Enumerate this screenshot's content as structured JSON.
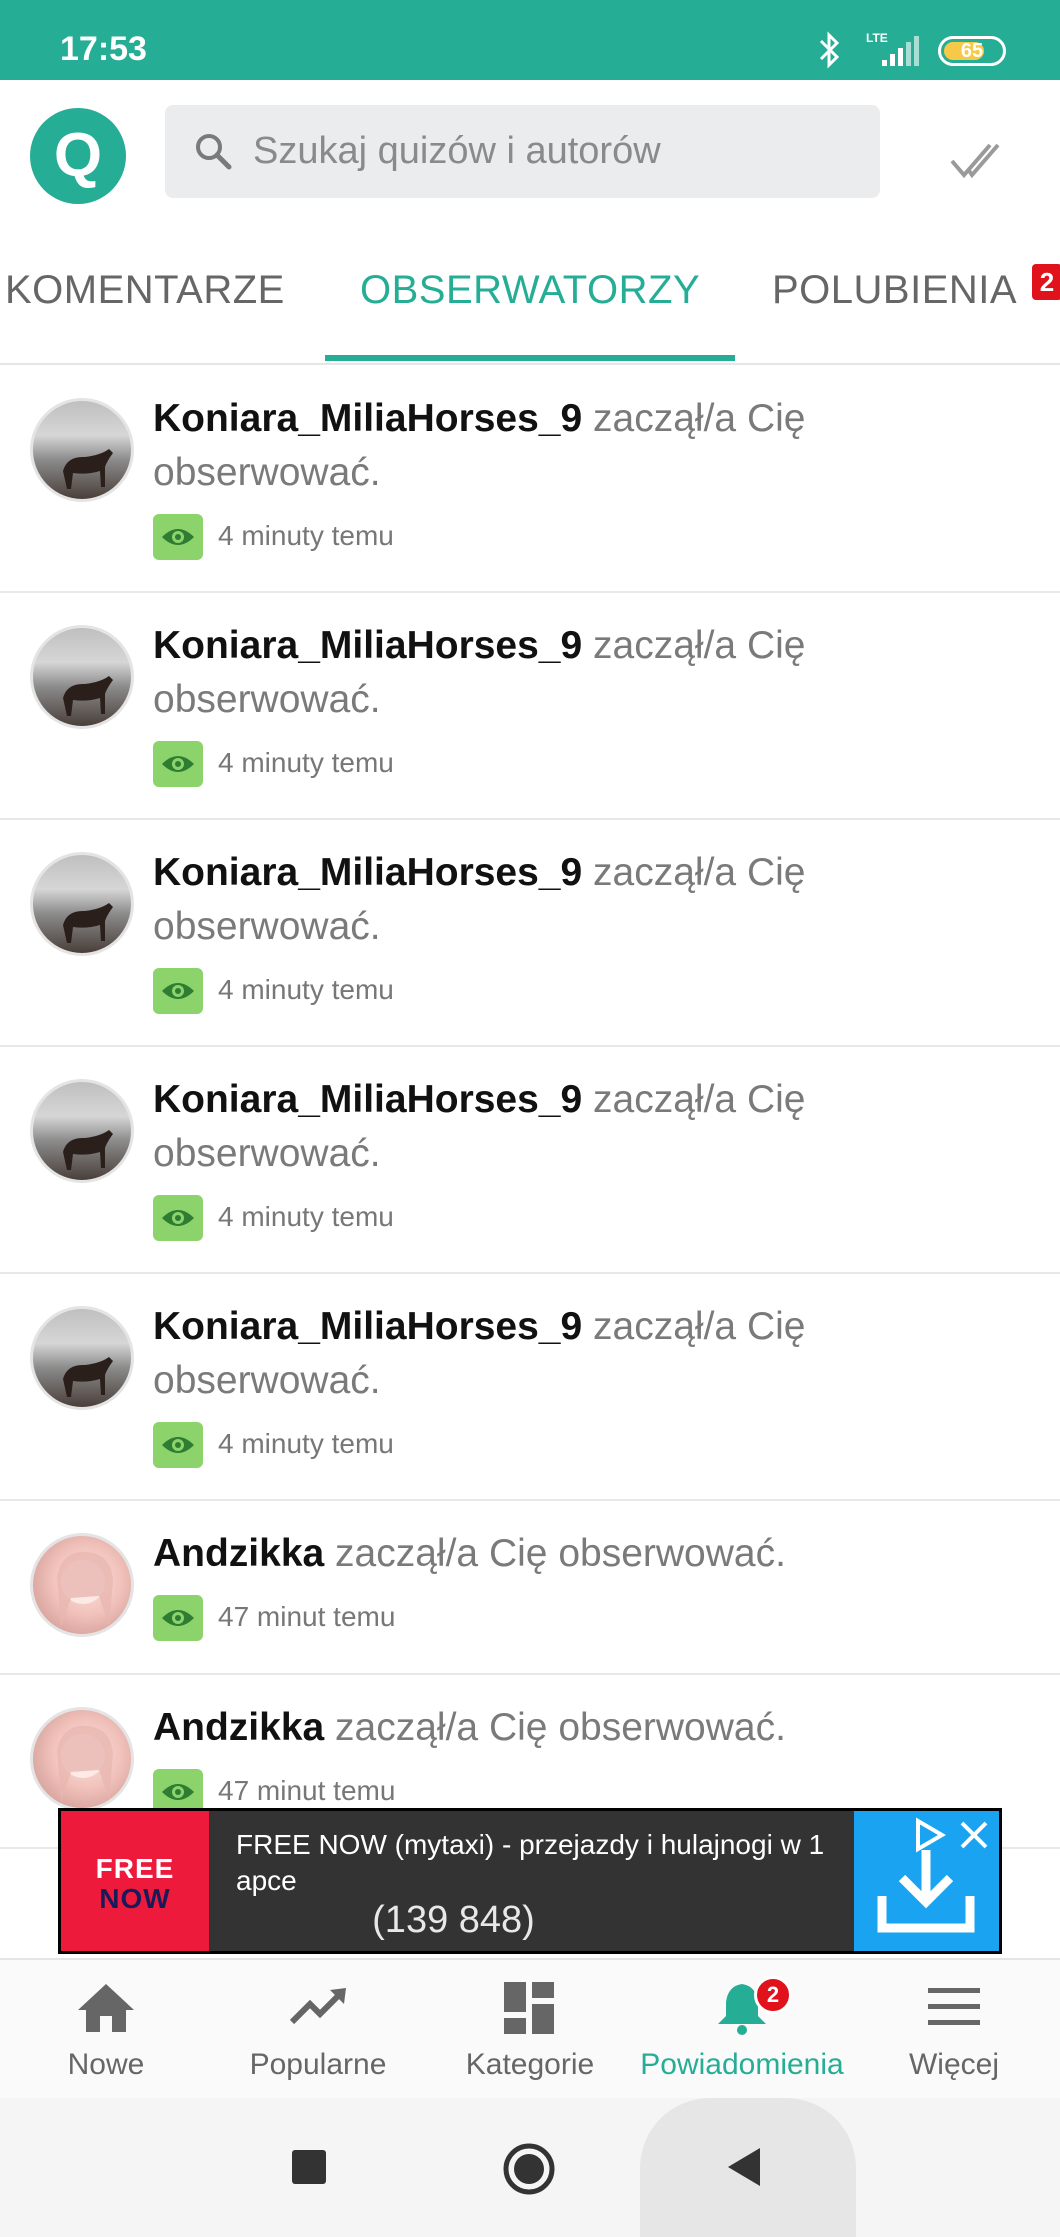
{
  "status_bar": {
    "time": "17:53",
    "network": "LTE",
    "battery": "65"
  },
  "header": {
    "logo_letter": "Q",
    "search_placeholder": "Szukaj quizów i autorów"
  },
  "tabs": [
    {
      "label": "KOMENTARZE",
      "active": false
    },
    {
      "label": "OBSERWATORZY",
      "active": true
    },
    {
      "label": "POLUBIENIA",
      "active": false,
      "badge": "2"
    }
  ],
  "notifications": [
    {
      "user": "Koniara_MiliaHorses_9",
      "message": " zaczął/a Cię obserwować.",
      "time": "4 minuty temu",
      "avatar": "horse"
    },
    {
      "user": "Koniara_MiliaHorses_9",
      "message": " zaczął/a Cię obserwować.",
      "time": "4 minuty temu",
      "avatar": "horse"
    },
    {
      "user": "Koniara_MiliaHorses_9",
      "message": " zaczął/a Cię obserwować.",
      "time": "4 minuty temu",
      "avatar": "horse"
    },
    {
      "user": "Koniara_MiliaHorses_9",
      "message": " zaczął/a Cię obserwować.",
      "time": "4 minuty temu",
      "avatar": "horse"
    },
    {
      "user": "Koniara_MiliaHorses_9",
      "message": " zaczął/a Cię obserwować.",
      "time": "4 minuty temu",
      "avatar": "horse"
    },
    {
      "user": "Andzikka",
      "message": " zaczął/a Cię obserwować.",
      "time": "47 minut temu",
      "avatar": "girl"
    },
    {
      "user": "Andzikka",
      "message": " zaczął/a Cię obserwować.",
      "time": "47 minut temu",
      "avatar": "girl"
    }
  ],
  "ad": {
    "logo_top": "FREE",
    "logo_bottom": "NOW",
    "title": "FREE NOW (mytaxi) - przejazdy i hulajnogi w 1 apce",
    "count": "(139 848)"
  },
  "bottom_nav": [
    {
      "label": "Nowe",
      "icon": "home-icon"
    },
    {
      "label": "Popularne",
      "icon": "trending-icon"
    },
    {
      "label": "Kategorie",
      "icon": "categories-icon"
    },
    {
      "label": "Powiadomienia",
      "icon": "bell-icon",
      "active": true,
      "badge": "2"
    },
    {
      "label": "Więcej",
      "icon": "menu-icon"
    }
  ],
  "colors": {
    "accent": "#26ad95",
    "badge": "#e0121b",
    "eye_badge": "#8cd36c",
    "ad_action": "#1aa3f0",
    "ad_logo": "#ee1a3c"
  }
}
